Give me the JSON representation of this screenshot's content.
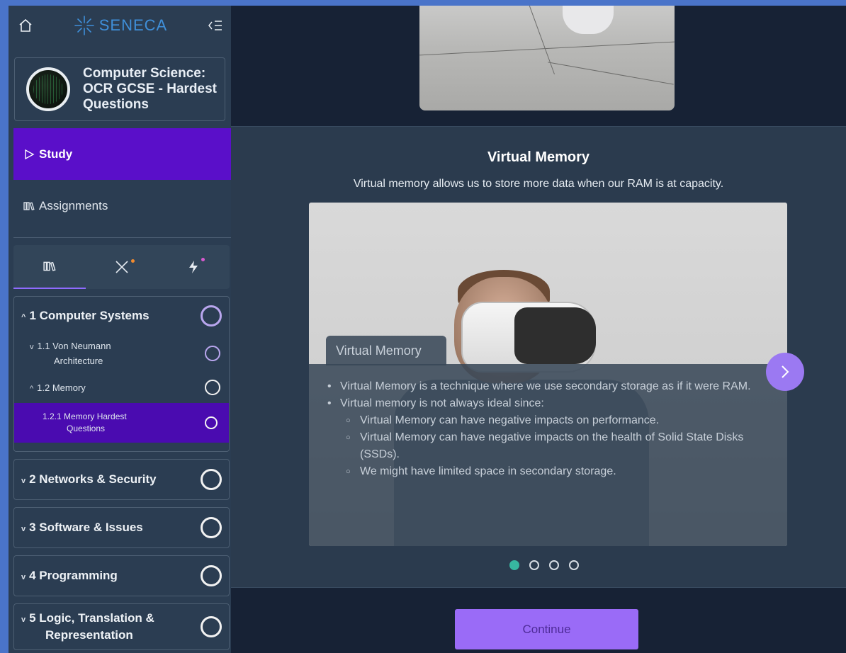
{
  "brand": {
    "name": "SENECA",
    "color": "#3f8fd9"
  },
  "sidebar": {
    "course_title": "Computer Science: OCR GCSE - Hardest Questions",
    "nav": {
      "study": "Study",
      "assignments": "Assignments"
    },
    "tabs": [
      {
        "icon": "books-icon"
      },
      {
        "icon": "x-icon",
        "badge_color": "#f28b2f"
      },
      {
        "icon": "lightning-icon",
        "badge_color": "#d85ad0"
      }
    ],
    "sections": [
      {
        "label": "1 Computer Systems",
        "expanded": true,
        "subs": [
          {
            "label": "1.1 Von Neumann Architecture",
            "l1": "1.1 Von Neumann",
            "l2": "Architecture"
          },
          {
            "label": "1.2 Memory"
          },
          {
            "label": "1.2.1 Memory Hardest Questions",
            "l1": "1.2.1 Memory Hardest",
            "l2": "Questions"
          }
        ]
      },
      {
        "label": "2 Networks & Security"
      },
      {
        "label": "3 Software & Issues"
      },
      {
        "label": "4 Programming"
      },
      {
        "label": "5 Logic, Translation & Representation",
        "l1": "5 Logic, Translation &",
        "l2": "Representation"
      }
    ]
  },
  "main": {
    "card_title": "Virtual Memory",
    "card_subtitle": "Virtual memory allows us to store more data when our RAM is at capacity.",
    "slide": {
      "tab_label": "Virtual Memory",
      "bullets": [
        "Virtual Memory is a technique where we use secondary storage as if it were RAM.",
        "Virtual memory is not always ideal since:"
      ],
      "sub_bullets": [
        "Virtual Memory can have negative impacts on performance.",
        "Virtual Memory can have negative impacts on the health of Solid State Disks (SSDs).",
        "We might have limited space in secondary storage."
      ]
    },
    "pager": {
      "count": 4,
      "active": 1,
      "active_color": "#37b6a0"
    },
    "continue_label": "Continue"
  }
}
